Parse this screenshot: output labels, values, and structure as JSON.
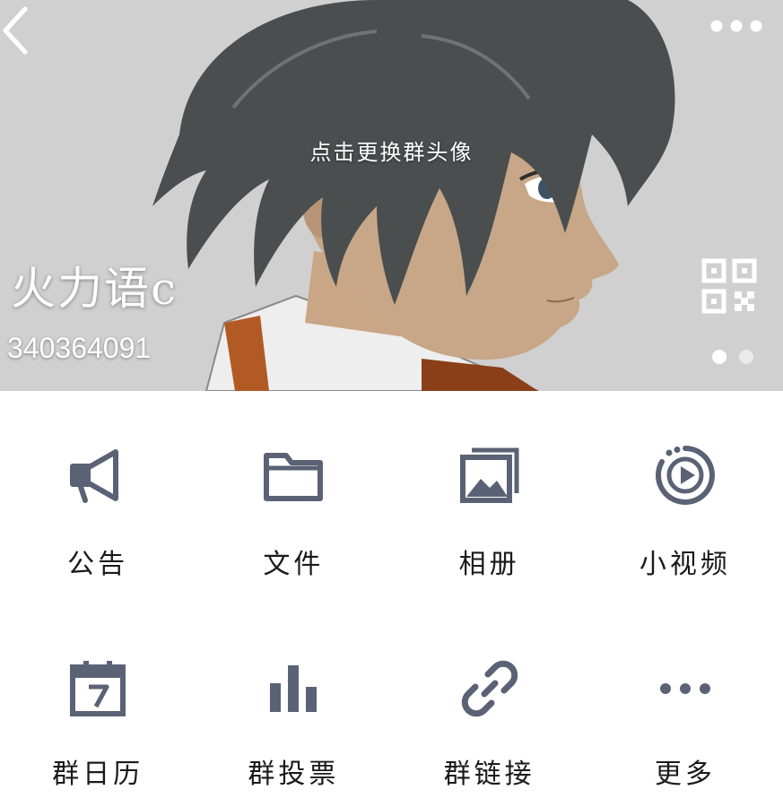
{
  "header": {
    "back_icon": "chevron-left-icon",
    "more_icon": "more-horizontal-icon",
    "avatar_hint": "点击更换群头像",
    "group_name": "火力语c",
    "group_id": "340364091",
    "qr_icon": "qr-code-icon",
    "pager": {
      "pages": 2,
      "current": 1
    }
  },
  "features": [
    {
      "label": "公告",
      "icon": "megaphone-icon"
    },
    {
      "label": "文件",
      "icon": "folder-icon"
    },
    {
      "label": "相册",
      "icon": "photo-album-icon"
    },
    {
      "label": "小视频",
      "icon": "short-video-icon"
    },
    {
      "label": "群日历",
      "icon": "calendar-icon"
    },
    {
      "label": "群投票",
      "icon": "bar-chart-icon"
    },
    {
      "label": "群链接",
      "icon": "link-icon"
    },
    {
      "label": "更多",
      "icon": "more-horizontal-icon"
    }
  ],
  "colors": {
    "icon": "#5b6275",
    "hero_bg": "#cfcfcf",
    "text": "#1a1a1a"
  }
}
